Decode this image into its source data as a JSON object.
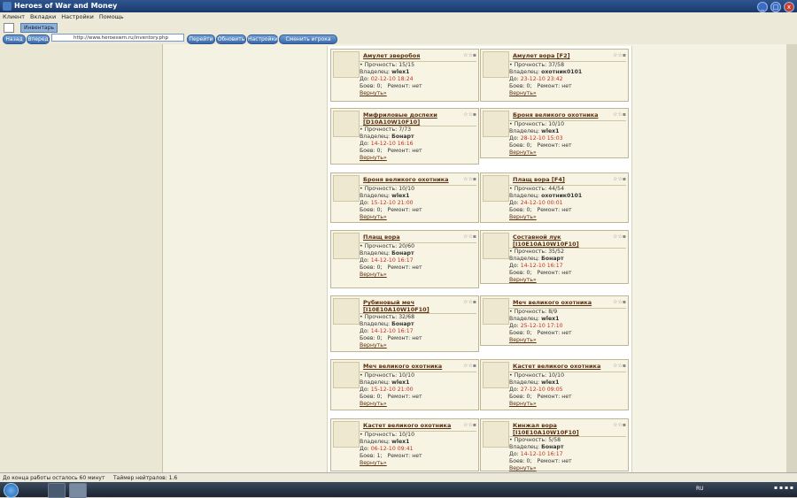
{
  "window": {
    "title": "Heroes of War and Money",
    "min": "_",
    "max": "□",
    "close": "x"
  },
  "menu": [
    "Клиент",
    "Вкладки",
    "Настройки",
    "Помощь"
  ],
  "tabs": [
    {
      "label": "Инвентарь"
    }
  ],
  "nav": {
    "back": "Назад",
    "forward": "Вперед",
    "url": "http://www.heroeswm.ru/inventory.php",
    "buttons": [
      "Перейти",
      "Обновить",
      "Настройки",
      "Сменить игрока"
    ]
  },
  "labels": {
    "durability": "Прочность:",
    "owner": "Владелец:",
    "until": "До:",
    "battles": "Боев:",
    "repair": "Ремонт:",
    "return": "Вернуть»"
  },
  "items": [
    {
      "name": "Амулет зверобоя",
      "durability": "15/15",
      "owner": "wlex1",
      "until": "02-12-10 18:24",
      "battles": "0",
      "repair": "нет",
      "icon": "amulet-icon"
    },
    {
      "name": "Амулет вора [F2]",
      "durability": "37/58",
      "owner": "охотник0101",
      "until": "23-12-10 23:42",
      "battles": "0",
      "repair": "нет",
      "icon": "amulet-icon"
    },
    {
      "name": "Мифриловые доспехи [D10A10W10F10]",
      "durability": "7/73",
      "owner": "Бонарт",
      "until": "14-12-10 16:16",
      "battles": "0",
      "repair": "нет",
      "icon": "armor-icon"
    },
    {
      "name": "Броня великого охотника",
      "durability": "10/10",
      "owner": "wlex1",
      "until": "28-12-10 15:03",
      "battles": "0",
      "repair": "нет",
      "icon": "armor-icon"
    },
    {
      "name": "Броня великого охотника",
      "durability": "10/10",
      "owner": "wlex1",
      "until": "15-12-10 21:00",
      "battles": "0",
      "repair": "нет",
      "icon": "armor-icon"
    },
    {
      "name": "Плащ вора [F4]",
      "durability": "44/54",
      "owner": "охотник0101",
      "until": "24-12-10 00:01",
      "battles": "0",
      "repair": "нет",
      "icon": "cloak-icon"
    },
    {
      "name": "Плащ вора",
      "durability": "20/60",
      "owner": "Бонарт",
      "until": "14-12-10 16:17",
      "battles": "0",
      "repair": "нет",
      "icon": "cloak-icon"
    },
    {
      "name": "Составной лук [I10E10A10W10F10]",
      "durability": "35/52",
      "owner": "Бонарт",
      "until": "14-12-10 16:17",
      "battles": "0",
      "repair": "нет",
      "icon": "bow-icon"
    },
    {
      "name": "Рубиновый меч [I10E10A10W10F10]",
      "durability": "32/68",
      "owner": "Бонарт",
      "until": "14-12-10 16:17",
      "battles": "0",
      "repair": "нет",
      "icon": "sword-icon"
    },
    {
      "name": "Меч великого охотника",
      "durability": "8/9",
      "owner": "wlex1",
      "until": "25-12-10 17:10",
      "battles": "0",
      "repair": "нет",
      "icon": "sword-icon"
    },
    {
      "name": "Меч великого охотника",
      "durability": "10/10",
      "owner": "wlex1",
      "until": "15-12-10 21:00",
      "battles": "0",
      "repair": "нет",
      "icon": "sword-icon"
    },
    {
      "name": "Кастет великого охотника",
      "durability": "10/10",
      "owner": "wlex1",
      "until": "27-12-10 09:05",
      "battles": "0",
      "repair": "нет",
      "icon": "knuckle-icon"
    },
    {
      "name": "Кастет великого охотника",
      "durability": "10/10",
      "owner": "wlex1",
      "until": "06-12-10 09:41",
      "battles": "1",
      "repair": "нет",
      "icon": "knuckle-icon"
    },
    {
      "name": "Кинжал вора [I10E10A10W10F10]",
      "durability": "5/58",
      "owner": "Бонарт",
      "until": "14-12-10 16:17",
      "battles": "0",
      "repair": "нет",
      "icon": "dagger-icon"
    }
  ],
  "status": {
    "left": "До конца работы осталось 60 минут",
    "right": "Таймер нейтралов: 1.6"
  },
  "taskbar": {
    "lang": "RU"
  }
}
